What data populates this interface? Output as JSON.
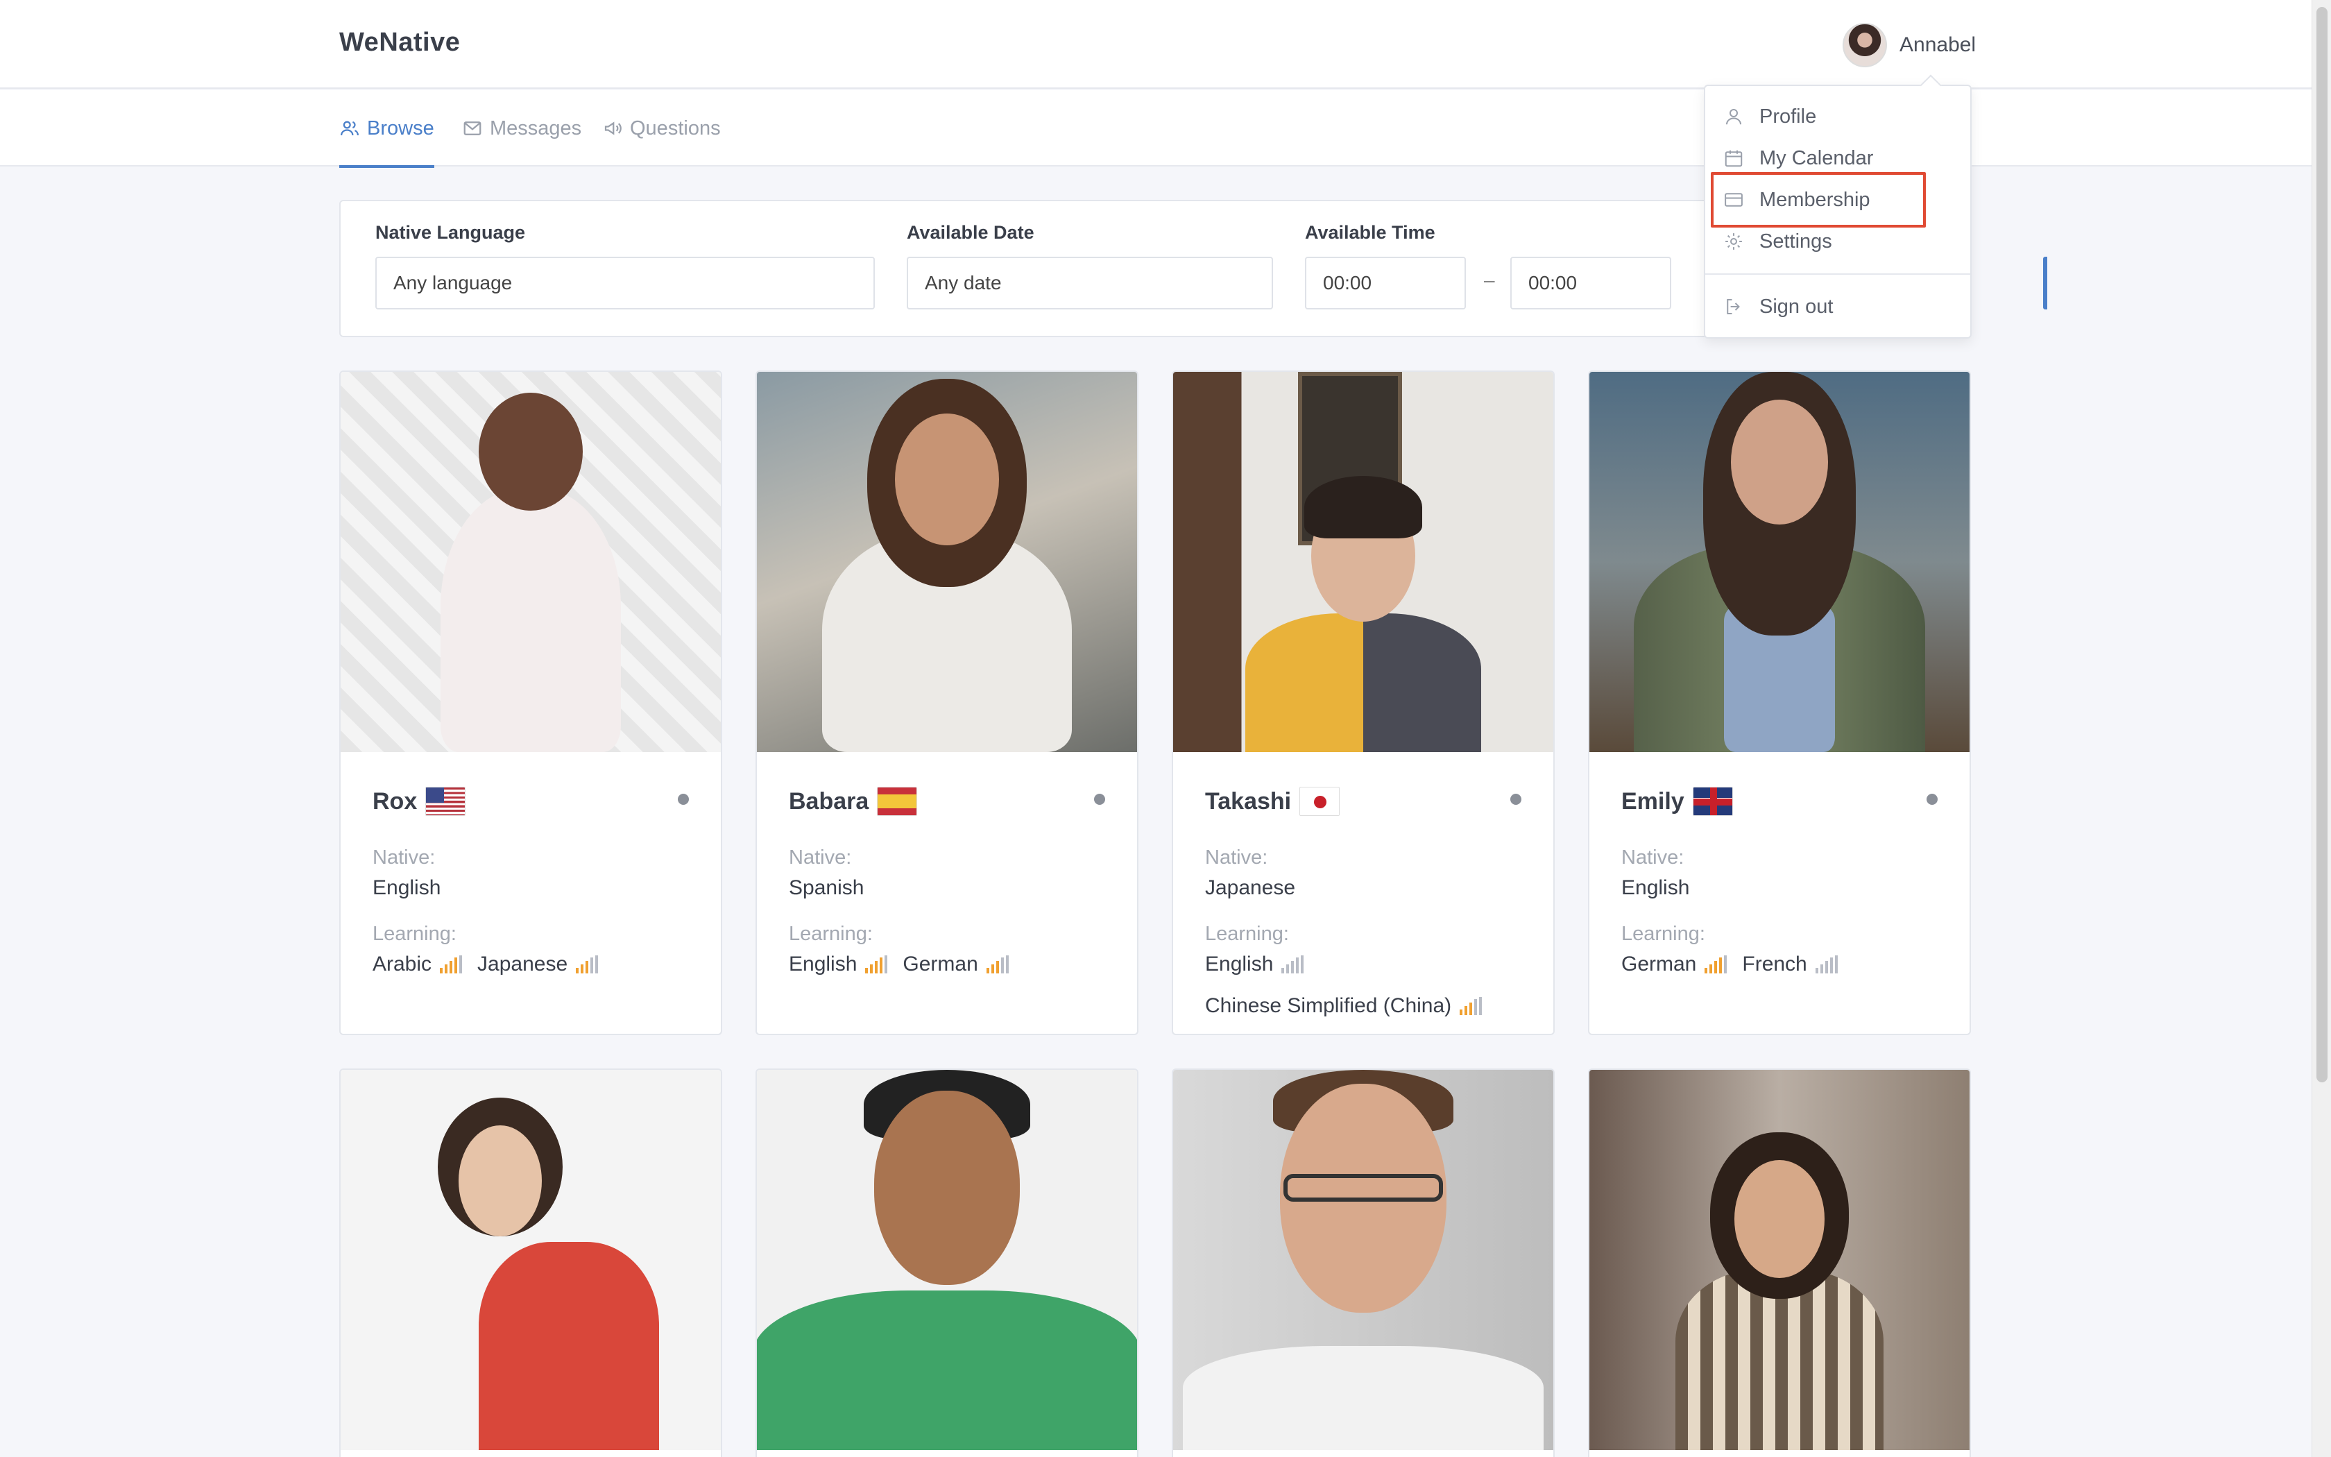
{
  "app": {
    "brand": "WeNative"
  },
  "user": {
    "name": "Annabel"
  },
  "tabs": [
    {
      "label": "Browse",
      "icon": "users-icon",
      "active": true
    },
    {
      "label": "Messages",
      "icon": "mail-icon",
      "active": false
    },
    {
      "label": "Questions",
      "icon": "megaphone-icon",
      "active": false
    }
  ],
  "filters": {
    "native_language": {
      "label": "Native Language",
      "value": "Any language"
    },
    "available_date": {
      "label": "Available Date",
      "value": "Any date"
    },
    "available_time": {
      "label": "Available Time",
      "from": "00:00",
      "separator": "–",
      "to": "00:00"
    }
  },
  "dropdown": {
    "items": [
      {
        "label": "Profile",
        "icon": "user-icon"
      },
      {
        "label": "My Calendar",
        "icon": "calendar-icon"
      },
      {
        "label": "Membership",
        "icon": "credit-card-icon",
        "highlighted": true
      },
      {
        "label": "Settings",
        "icon": "gear-icon"
      },
      {
        "label": "Sign out",
        "icon": "sign-out-icon"
      }
    ]
  },
  "labels": {
    "native": "Native:",
    "learning": "Learning:"
  },
  "cards": [
    {
      "name": "Rox",
      "flag": "us",
      "native": "English",
      "learning": [
        {
          "lang": "Arabic",
          "level": 4
        },
        {
          "lang": "Japanese",
          "level": 3
        }
      ]
    },
    {
      "name": "Babara",
      "flag": "es",
      "native": "Spanish",
      "learning": [
        {
          "lang": "English",
          "level": 4
        },
        {
          "lang": "German",
          "level": 3
        }
      ]
    },
    {
      "name": "Takashi",
      "flag": "jp",
      "native": "Japanese",
      "learning": [
        {
          "lang": "English",
          "level": 2
        },
        {
          "lang": "Chinese Simplified (China)",
          "level": 3
        }
      ]
    },
    {
      "name": "Emily",
      "flag": "gb",
      "native": "English",
      "learning": [
        {
          "lang": "German",
          "level": 4
        },
        {
          "lang": "French",
          "level": 2
        }
      ]
    }
  ],
  "colors": {
    "accent": "#4a7fc9",
    "level_on": "#f0a030",
    "level_off": "#b9bdc6",
    "highlight": "#e04a33"
  }
}
